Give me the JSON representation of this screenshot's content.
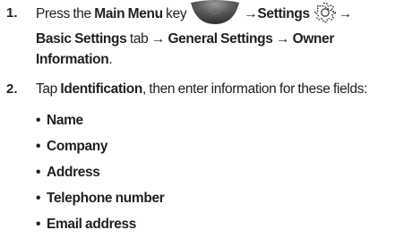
{
  "steps": [
    {
      "number": "1.",
      "line1": {
        "press": "Press the ",
        "main_menu": "Main Menu",
        "key": " key",
        "arrow_settings": "→Settings",
        "arrow_end": "→"
      },
      "line2": {
        "basic_settings": "Basic Settings",
        "tab_arrow": " tab ",
        "arrow1": "→",
        "general_settings": " General Settings ",
        "arrow2": "→",
        "owner": " Owner"
      },
      "line3": {
        "information": "Information",
        "period": "."
      },
      "icons": {
        "menu_key": "main-menu-key-icon",
        "settings": "settings-gear-icon"
      }
    },
    {
      "number": "2.",
      "line1": {
        "tap": "Tap ",
        "identification": "Identification",
        "rest": ", then enter information for these fields:"
      },
      "bullet_char": "•",
      "bullets": [
        "Name",
        "Company",
        "Address",
        "Telephone number",
        "Email address"
      ]
    }
  ],
  "colors": {
    "text": "#231f20",
    "menu_key_dark": "#3a3a3a",
    "menu_key_light": "#8c8c8c"
  }
}
